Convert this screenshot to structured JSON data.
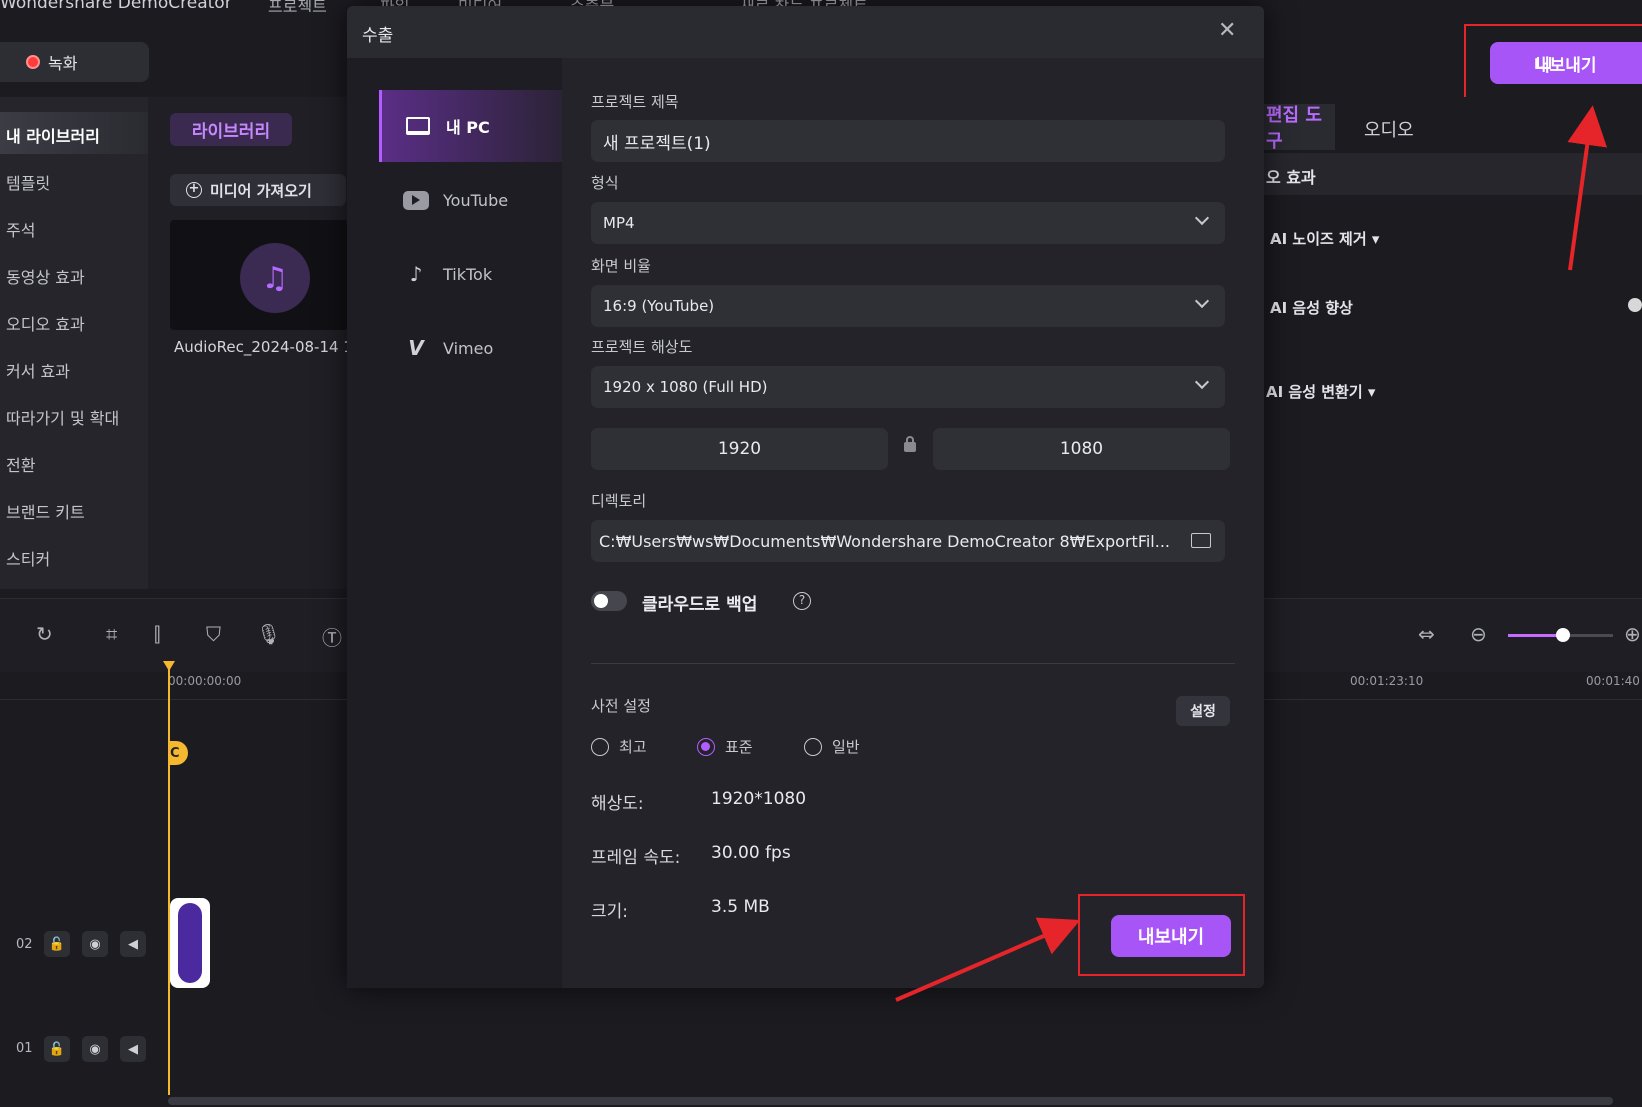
{
  "app": {
    "title": "Wondershare DemoCreator",
    "menu": [
      "프로젝트",
      "파일",
      "미디어",
      "수출물",
      "새로 찾는 프로젝트"
    ]
  },
  "toolbar": {
    "record_label": "녹화",
    "export_label": "내보내기"
  },
  "left_nav": {
    "active": "내 라이브러리",
    "items": [
      "템플릿",
      "주석",
      "동영상 효과",
      "오디오 효과",
      "커서 효과",
      "따라가기 및 확대",
      "전환",
      "브랜드 키트",
      "스티커"
    ]
  },
  "library": {
    "tab_label": "라이브러리",
    "import_label": "미디어 가져오기",
    "media_name": "AudioRec_2024-08-14 1"
  },
  "right_panel": {
    "tab_active": "편집 도구",
    "tab_other": "오디오",
    "section": "오 효과",
    "items": [
      "AI 노이즈 제거 ▾",
      "AI 음성 향상",
      "AI 음성 변환기 ▾"
    ]
  },
  "timeline": {
    "start_time": "00:00:00:00",
    "time_mark_1": "00:01:23:10",
    "time_mark_2": "00:01:40",
    "marker_label": "C",
    "tracks": [
      {
        "number": "02"
      },
      {
        "number": "01"
      }
    ]
  },
  "export_dialog": {
    "title": "수출",
    "destinations": [
      "내 PC",
      "YouTube",
      "TikTok",
      "Vimeo"
    ],
    "project_title_label": "프로젝트 제목",
    "project_title_value": "새 프로젝트(1)",
    "format_label": "형식",
    "format_value": "MP4",
    "aspect_label": "화면 비율",
    "aspect_value": "16:9 (YouTube)",
    "resolution_label": "프로젝트 해상도",
    "resolution_value": "1920 x 1080 (Full HD)",
    "width_value": "1920",
    "height_value": "1080",
    "directory_label": "디렉토리",
    "directory_value": "C:₩Users₩ws₩Documents₩Wondershare DemoCreator 8₩ExportFil...",
    "cloud_backup_label": "클라우드로 백업",
    "preset_label": "사전 설정",
    "settings_button": "설정",
    "quality_options": [
      "최고",
      "표준",
      "일반"
    ],
    "quality_selected": "표준",
    "info": {
      "resolution_label": "해상도:",
      "resolution_value": "1920*1080",
      "framerate_label": "프레임 속도:",
      "framerate_value": "30.00 fps",
      "size_label": "크기:",
      "size_value": "3.5 MB"
    },
    "export_button": "내보내기"
  },
  "colors": {
    "accent": "#a855f7",
    "highlight_box": "#e5252a",
    "playhead": "#f5b82e"
  }
}
